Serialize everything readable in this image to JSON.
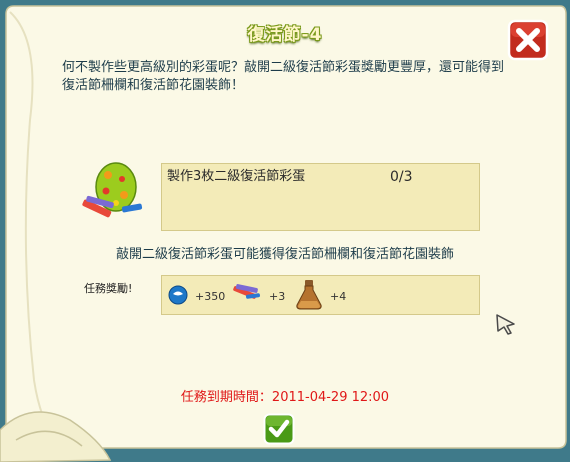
{
  "dialog": {
    "title": "復活節-4",
    "intro": "何不製作些更高級別的彩蛋呢？敲開二級復活節彩蛋獎勵更豐厚，還可能得到復活節柵欄和復活節花園裝飾！",
    "task": {
      "label": "製作3枚二級復活節彩蛋",
      "progress": "0/3",
      "icon": "easter-egg-with-crayons-icon"
    },
    "description": "敲開二級復活節彩蛋可能獲得復活節柵欄和復活節花園裝飾",
    "rewards": {
      "label": "任務獎勵!",
      "items": [
        {
          "icon": "experience-orb-icon",
          "value": "+350"
        },
        {
          "icon": "crayons-icon",
          "value": "+3"
        },
        {
          "icon": "potion-flask-icon",
          "value": "+4"
        }
      ]
    },
    "expiry": "任務到期時間：2011-04-29 12:00"
  }
}
